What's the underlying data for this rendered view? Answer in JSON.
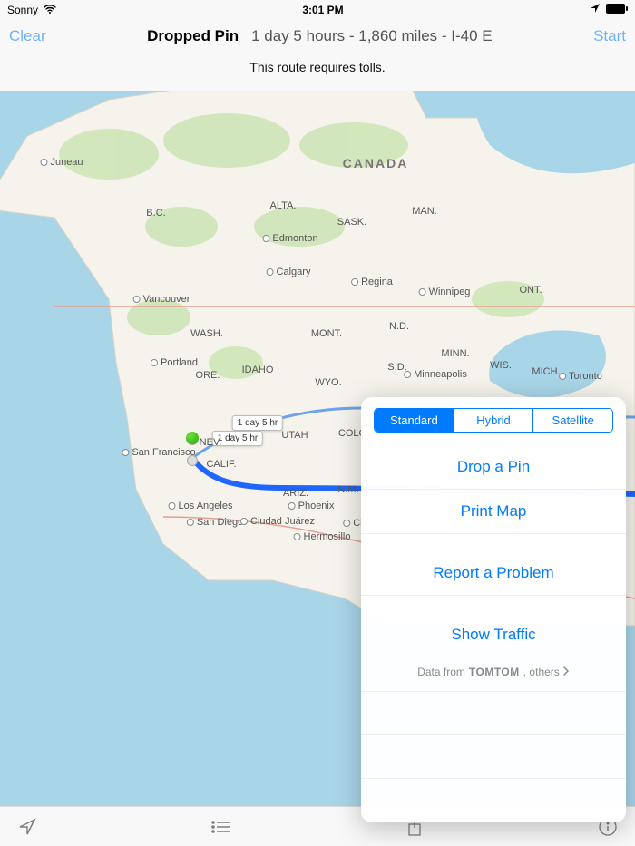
{
  "status": {
    "carrier": "Sonny",
    "time": "3:01 PM"
  },
  "nav": {
    "clear": "Clear",
    "title_strong": "Dropped Pin",
    "title_rest": "1 day 5 hours - 1,860 miles - I-40 E",
    "start": "Start"
  },
  "notice": "This route requires tolls.",
  "route_tips": {
    "a": "1 day 5 hr",
    "b": "1 day 5 hr"
  },
  "map_labels": {
    "canada": "CANADA",
    "bc": "B.C.",
    "alta": "ALTA.",
    "sask": "SASK.",
    "man": "MAN.",
    "ont": "ONT.",
    "wash": "WASH.",
    "ore": "ORE.",
    "idaho": "IDAHO",
    "mont": "MONT.",
    "nd": "N.D.",
    "sd": "S.D.",
    "wyo": "WYO.",
    "minn": "MINN.",
    "wis": "WIS.",
    "mich": "MICH.",
    "calif": "CALIF.",
    "nev": "NEV.",
    "utah": "UTAH",
    "colo": "COLO.",
    "ariz": "ARIZ.",
    "nm": "N.M.",
    "juneau": "Juneau",
    "edmonton": "Edmonton",
    "calgary": "Calgary",
    "regina": "Regina",
    "winnipeg": "Winnipeg",
    "vancouver": "Vancouver",
    "portland": "Portland",
    "sf": "San Francisco",
    "la": "Los Angeles",
    "sd_city": "San Diego",
    "phoenix": "Phoenix",
    "minneapolis": "Minneapolis",
    "toronto": "Toronto",
    "ciudad": "Ciudad Juárez",
    "hermosillo": "Hermosillo",
    "chi": "Chi"
  },
  "popover": {
    "seg": {
      "standard": "Standard",
      "hybrid": "Hybrid",
      "satellite": "Satellite"
    },
    "drop_pin": "Drop a Pin",
    "print": "Print Map",
    "report": "Report a Problem",
    "traffic": "Show Traffic",
    "attr_prefix": "Data from",
    "attr_brand": "TOMTOM",
    "attr_suffix": ", others"
  }
}
